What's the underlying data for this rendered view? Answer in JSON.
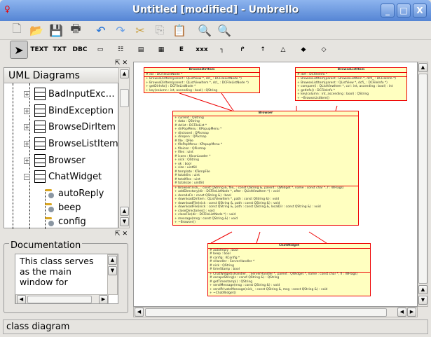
{
  "window": {
    "title": "Untitled [modified] - Umbrello",
    "minimize": "_",
    "maximize": "□",
    "close": "X"
  },
  "toolbar1": [
    {
      "icon": "new-icon",
      "g": "🗋"
    },
    {
      "icon": "open-icon",
      "g": "📂"
    },
    {
      "icon": "save-icon",
      "g": "💾"
    },
    {
      "icon": "print-icon",
      "g": "🖶"
    },
    {
      "icon": "undo-icon",
      "g": "↶"
    },
    {
      "icon": "redo-icon",
      "g": "↷"
    },
    {
      "icon": "cut-icon",
      "g": "✂"
    },
    {
      "icon": "copy-icon",
      "g": "⎘"
    },
    {
      "icon": "paste-icon",
      "g": "📋"
    },
    {
      "icon": "zoom-icon",
      "g": "🔍"
    },
    {
      "icon": "zoom-100-icon",
      "g": "🔍"
    }
  ],
  "toolbar2": [
    {
      "icon": "select-arrow-icon",
      "g": "➤"
    },
    {
      "icon": "text-icon",
      "g": "TEXT"
    },
    {
      "icon": "note-icon",
      "g": "TXT"
    },
    {
      "icon": "dbc-icon",
      "g": "DBC"
    },
    {
      "icon": "box-icon",
      "g": "▭"
    },
    {
      "icon": "class-icon",
      "g": "☷"
    },
    {
      "icon": "interface-icon",
      "g": "▤"
    },
    {
      "icon": "datatype-icon",
      "g": "▦"
    },
    {
      "icon": "enum-icon",
      "g": "E"
    },
    {
      "icon": "package-icon",
      "g": "xxx"
    },
    {
      "icon": "association-icon",
      "g": "┐"
    },
    {
      "icon": "directional-association-icon",
      "g": "↱"
    },
    {
      "icon": "dependency-icon",
      "g": "⇡"
    },
    {
      "icon": "generalization-icon",
      "g": "△"
    },
    {
      "icon": "composition-icon",
      "g": "◆"
    },
    {
      "icon": "aggregation-icon",
      "g": "◇"
    }
  ],
  "tree": {
    "header": "UML Diagrams",
    "items": [
      {
        "label": "BadInputExc…",
        "type": "class",
        "expander": "+"
      },
      {
        "label": "BindException",
        "type": "class",
        "expander": "+"
      },
      {
        "label": "BrowseDirItem",
        "type": "class",
        "expander": "+"
      },
      {
        "label": "BrowseListItem",
        "type": "class",
        "expander": "+"
      },
      {
        "label": "Browser",
        "type": "class",
        "expander": "+"
      },
      {
        "label": "ChatWidget",
        "type": "class",
        "expander": "−"
      },
      {
        "label": "autoReply",
        "type": "attribute"
      },
      {
        "label": "beep",
        "type": "attribute"
      },
      {
        "label": "config",
        "type": "attribute"
      }
    ]
  },
  "documentation": {
    "title": "Documentation",
    "text": "This class serves as the main window for"
  },
  "status": "class diagram",
  "classes": {
    "browsedir": {
      "name": "BrowseDirItem",
      "attrs": [
        "# dcl : DCFileListNode *"
      ],
      "ops": [
        "+ BrowseDirItem(parent : QListView *, dcl_ : DCFileListNode *)",
        "+ BrowseDirItem(parent : QListViewItem *, dcl_ : DCFileListNode *)",
        "+ getDirInfo() : DCFileListNode *",
        "+ key(column : int, ascending : bool) : QString"
      ]
    },
    "browselist": {
      "name": "BrowseListItem",
      "attrs": [
        "# dcfi : DCFileInfo *"
      ],
      "ops": [
        "+ BrowseListItem(parent : BrowseListItem *, dcfi_ : DCFileInfo *)",
        "+ BrowseListItem(parent : QListView *, dcfi_ : DCFileInfo *)",
        "+ compare(i : QListViewItem *, col : int, ascending : bool) : int",
        "+ getInfo() : DCFileInfo *",
        "+ key(column : int, ascending : bool) : QString",
        "+ ~BrowseListItem()"
      ]
    },
    "browser": {
      "name": "Browser",
      "attrs": [
        "+ current : QString",
        "+ data : QString",
        "# dclist : DCFileList *",
        "+ dirPopMenu : KPopupMenu *",
        "+ dirclosed : QPixmap",
        "+ diropen : QPixmap",
        "# file : QFile",
        "+ filePopMenu : KPopupMenu *",
        "+ fileicon : QPixmap",
        "+ files : uint",
        "# icons : KIconLoader *",
        "+ nick : QString",
        "+ ok : bool",
        "+ size : uint64",
        "# template : KTempFile",
        "# totaldirs : uint",
        "# totalfiles : uint",
        "# totalsize : uint64"
      ],
      "ops": [
        "+ Browser(nick_ : const QString &, file_ : const QString &, parent : QWidget *, name : const char *, f : WFlags)",
        "+ addDirectory(dir : DCFileListNode *, after : QListViewItem *) : void",
        "+ decodeFn : const QString &) : bool",
        "+ downloadDirItem : QListViewItem *, path : const QString &) : void",
        "+ downloadFile(nick : const QString &, path : const QString &) : void",
        "+ downloadFile(nick : const QString &, path : const QString &, localDir : const QString &) : void",
        "+ closeDirectories() : void",
        "+ closeFile(dir : DCFileListNode *) : void",
        "+ message(msg : const QString &) : void",
        "+ ~Browser()"
      ]
    },
    "chatwidget": {
      "name": "ChatWidget",
      "attrs": [
        "# autoReply : bool",
        "# beep : bool",
        "# config : KConfig *",
        "# sHandler : ServerHandler *",
        "# nick : QString",
        "# timeStamp : bool"
      ],
      "ops": [
        "+ ChatWidget(sHandler_ : ServerHandler *, parent : QWidget *, name : const char *, fl : WFlags)",
        "# escapeString(s : const QString &) : QString",
        "# getTimestamp() : QString",
        "+ sendMessage(msg : const QString &) : void",
        "+ sendPrivateMessage(nick_ : const QString &, msg : const QString &) : void",
        "+ ~ChatWidget()"
      ]
    }
  },
  "colors": {
    "classFill": "#ffffc0",
    "classBorder": "#e00000",
    "titlebar": "#5585d4"
  }
}
